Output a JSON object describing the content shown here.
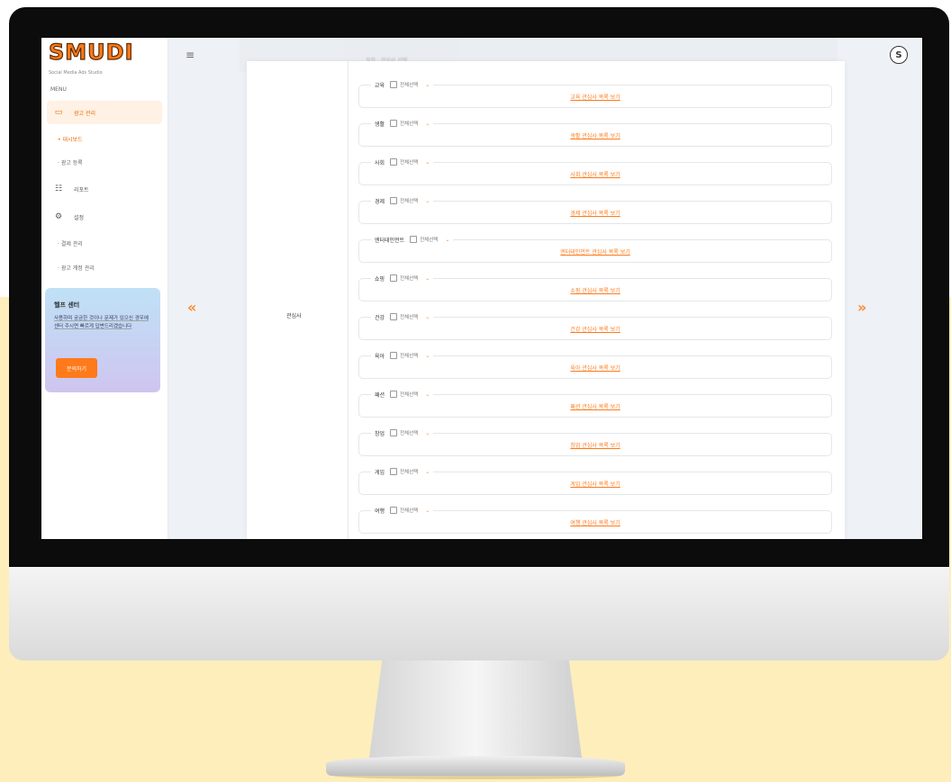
{
  "sidebar": {
    "logo": "SMUDI",
    "tagline": "Social Media Ads Studio",
    "menu_caption": "MENU",
    "items": [
      {
        "label": "광고 관리",
        "icon": "monitor-icon",
        "active": true
      },
      {
        "label": "대시보드",
        "sub": true,
        "active": true
      },
      {
        "label": "광고 등록",
        "sub": true
      },
      {
        "label": "리포트",
        "icon": "chart-icon"
      },
      {
        "label": "설정",
        "icon": "gear-icon"
      },
      {
        "label": "결제 관리",
        "sub": true
      },
      {
        "label": "광고 계정 관리",
        "sub": true
      }
    ],
    "help": {
      "title": "헬프 센터",
      "body": "사용하며 궁금한 것이나 문제가 있으신 경우에 센터 주시면 빠르게 답변드리겠습니다",
      "button": "문의하기"
    }
  },
  "header": {
    "menu_icon": "≡",
    "avatar": "S",
    "blurred_title": "설정 · 관심사 선택"
  },
  "nav": {
    "prev": "«",
    "next": "»"
  },
  "form": {
    "row_label": "관심사",
    "categories": [
      {
        "name": "교육",
        "select_all": "전체선택",
        "link": "교육 관심사 목록 보기"
      },
      {
        "name": "생활",
        "select_all": "전체선택",
        "link": "생활 관심사 목록 보기"
      },
      {
        "name": "사회",
        "select_all": "전체선택",
        "link": "사회 관심사 목록 보기"
      },
      {
        "name": "경제",
        "select_all": "전체선택",
        "link": "경제 관심사 목록 보기"
      },
      {
        "name": "엔터테인먼트",
        "select_all": "전체선택",
        "link": "엔터테인먼트 관심사 목록 보기"
      },
      {
        "name": "쇼핑",
        "select_all": "전체선택",
        "link": "쇼핑 관심사 목록 보기"
      },
      {
        "name": "건강",
        "select_all": "전체선택",
        "link": "건강 관심사 목록 보기"
      },
      {
        "name": "육아",
        "select_all": "전체선택",
        "link": "육아 관심사 목록 보기"
      },
      {
        "name": "패션",
        "select_all": "전체선택",
        "link": "패션 관심사 목록 보기"
      },
      {
        "name": "창업",
        "select_all": "전체선택",
        "link": "창업 관심사 목록 보기"
      },
      {
        "name": "게임",
        "select_all": "전체선택",
        "link": "게임 관심사 목록 보기"
      },
      {
        "name": "여행",
        "select_all": "전체선택",
        "link": "여행 관심사 목록 보기"
      }
    ]
  },
  "colors": {
    "accent": "#ff7a1a",
    "background_band": "#fdeebb",
    "active_bg": "#fff1e4"
  }
}
